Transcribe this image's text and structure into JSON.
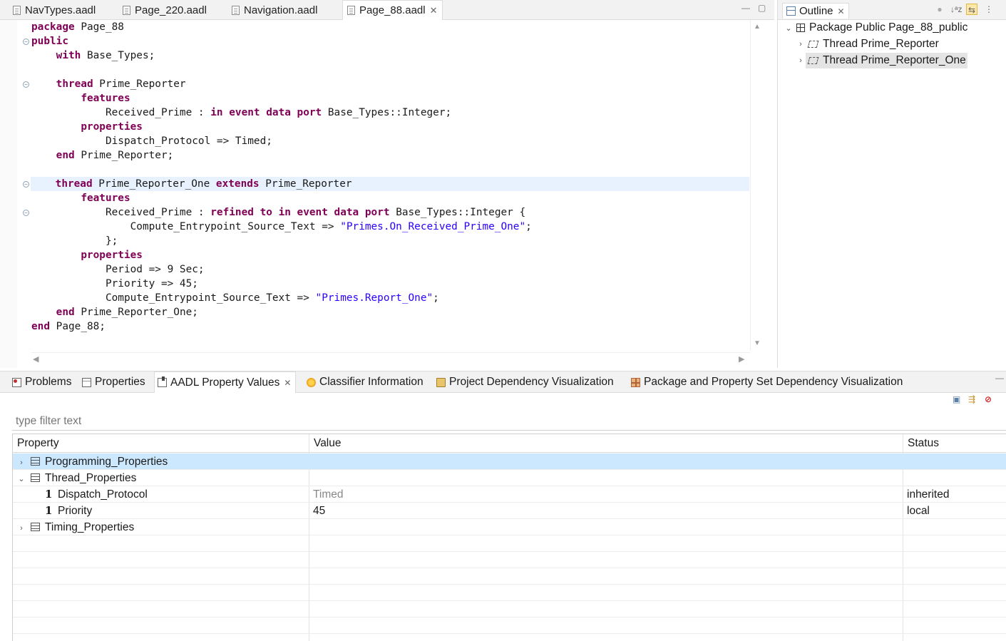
{
  "editor": {
    "tabs": [
      {
        "label": "NavTypes.aadl"
      },
      {
        "label": "Page_220.aadl"
      },
      {
        "label": "Navigation.aadl"
      },
      {
        "label": "Page_88.aadl",
        "close": "✕"
      }
    ],
    "window_buttons": {
      "minimize": "—",
      "maximize": "▢"
    },
    "lines": [
      [
        {
          "k": "package"
        },
        {
          "t": " Page_88"
        }
      ],
      [
        {
          "k": "public"
        }
      ],
      [
        {
          "t": "    "
        },
        {
          "k": "with"
        },
        {
          "t": " Base_Types;"
        }
      ],
      [],
      [
        {
          "t": "    "
        },
        {
          "k": "thread"
        },
        {
          "t": " Prime_Reporter"
        }
      ],
      [
        {
          "t": "        "
        },
        {
          "k": "features"
        }
      ],
      [
        {
          "t": "            Received_Prime : "
        },
        {
          "k": "in event data port"
        },
        {
          "t": " Base_Types::Integer;"
        }
      ],
      [
        {
          "t": "        "
        },
        {
          "k": "properties"
        }
      ],
      [
        {
          "t": "            Dispatch_Protocol => Timed;"
        }
      ],
      [
        {
          "t": "    "
        },
        {
          "k": "end"
        },
        {
          "t": " Prime_Reporter;"
        }
      ],
      [],
      [
        {
          "t": "    "
        },
        {
          "k": "thread"
        },
        {
          "t": " Prime_Reporter_One "
        },
        {
          "k": "extends"
        },
        {
          "t": " Prime_Reporter"
        }
      ],
      [
        {
          "t": "        "
        },
        {
          "k": "features"
        }
      ],
      [
        {
          "t": "            Received_Prime : "
        },
        {
          "k": "refined to in event data port"
        },
        {
          "t": " Base_Types::Integer {"
        }
      ],
      [
        {
          "t": "                Compute_Entrypoint_Source_Text => "
        },
        {
          "s": "\"Primes.On_Received_Prime_One\""
        },
        {
          "t": ";"
        }
      ],
      [
        {
          "t": "            };"
        }
      ],
      [
        {
          "t": "        "
        },
        {
          "k": "properties"
        }
      ],
      [
        {
          "t": "            Period => 9 Sec;"
        }
      ],
      [
        {
          "t": "            Priority => 45;"
        }
      ],
      [
        {
          "t": "            Compute_Entrypoint_Source_Text => "
        },
        {
          "s": "\"Primes.Report_One\""
        },
        {
          "t": ";"
        }
      ],
      [
        {
          "t": "    "
        },
        {
          "k": "end"
        },
        {
          "t": " Prime_Reporter_One;"
        }
      ],
      [
        {
          "k": "end"
        },
        {
          "t": " Page_88;"
        }
      ]
    ],
    "highlight_line": 11,
    "fold_lines": [
      1,
      4,
      11,
      13
    ],
    "scroll": {
      "up": "▲",
      "down": "▼",
      "left": "◀",
      "right": "▶"
    }
  },
  "outline": {
    "title": "Outline",
    "close": "✕",
    "tools": [
      "●",
      "↓ᵃz",
      "⇆",
      "⋮"
    ],
    "items": [
      {
        "label": "Package Public Page_88_public",
        "chevron": "⌄",
        "icon": "package-icon"
      },
      {
        "label": "Thread Prime_Reporter",
        "chevron": "›",
        "icon": "thread-icon"
      },
      {
        "label": "Thread Prime_Reporter_One",
        "chevron": "›",
        "icon": "thread-icon",
        "selected": true
      }
    ]
  },
  "bottom": {
    "tabs": [
      {
        "label": "Problems",
        "icon": "problems-icon"
      },
      {
        "label": "Properties",
        "icon": "properties-icon"
      },
      {
        "label": "AADL Property Values",
        "icon": "aadl-icon",
        "close": "✕"
      },
      {
        "label": "Classifier Information",
        "icon": "classifier-icon"
      },
      {
        "label": "Project Dependency Visualization",
        "icon": "folder-icon"
      },
      {
        "label": "Package and Property Set Dependency Visualization",
        "icon": "grid-icon"
      }
    ],
    "filter_placeholder": "type filter text",
    "view_tools": [
      "▣",
      "⇶",
      "⊘"
    ],
    "columns": [
      "Property",
      "Value",
      "Status"
    ],
    "rows": [
      {
        "chevron": "›",
        "icon": "table",
        "property": "Programming_Properties",
        "value": "",
        "status": "",
        "selected": true,
        "indent": 0
      },
      {
        "chevron": "⌄",
        "icon": "table",
        "property": "Thread_Properties",
        "value": "",
        "status": "",
        "indent": 0
      },
      {
        "chevron": "",
        "icon": "1",
        "property": "Dispatch_Protocol",
        "value": "Timed",
        "status": "inherited",
        "muted": true,
        "indent": 1
      },
      {
        "chevron": "",
        "icon": "1",
        "property": "Priority",
        "value": "45",
        "status": "local",
        "indent": 1
      },
      {
        "chevron": "›",
        "icon": "table",
        "property": "Timing_Properties",
        "value": "",
        "status": "",
        "indent": 0
      }
    ],
    "min_btn": "—"
  },
  "colors": {
    "keyword": "#7f0055",
    "string": "#2a00ff",
    "line_highlight": "#e8f2fe",
    "selection": "#cce8ff"
  }
}
